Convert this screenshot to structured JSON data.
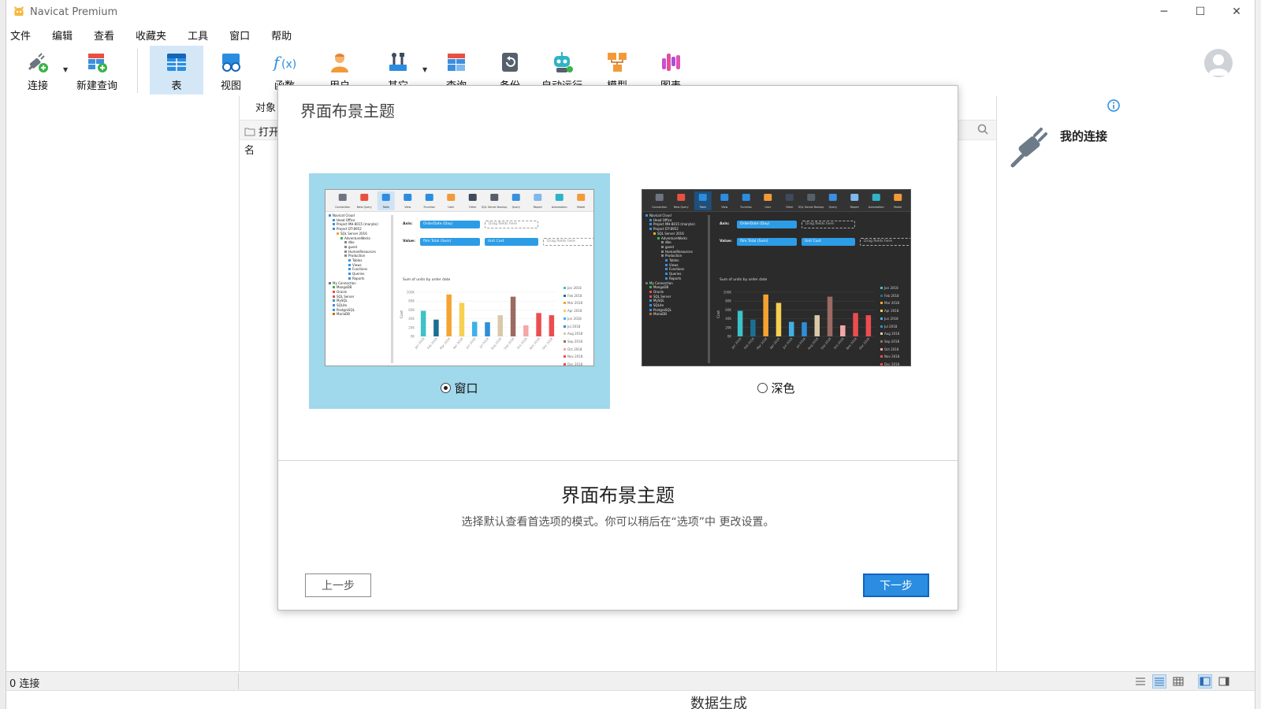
{
  "app": {
    "title": "Navicat Premium"
  },
  "menu": [
    "文件",
    "编辑",
    "查看",
    "收藏夹",
    "工具",
    "窗口",
    "帮助"
  ],
  "toolbar": [
    {
      "label": "连接",
      "icon": "connection-icon",
      "dropdown": true
    },
    {
      "label": "新建查询",
      "icon": "new-query-icon"
    },
    {
      "label": "表",
      "icon": "table-icon",
      "active": true
    },
    {
      "label": "视图",
      "icon": "view-icon"
    },
    {
      "label": "函数",
      "icon": "function-icon"
    },
    {
      "label": "用户",
      "icon": "user-icon"
    },
    {
      "label": "其它",
      "icon": "other-tools-icon",
      "dropdown": true
    },
    {
      "label": "查询",
      "icon": "query-icon"
    },
    {
      "label": "备份",
      "icon": "backup-icon"
    },
    {
      "label": "自动运行",
      "icon": "automation-icon"
    },
    {
      "label": "模型",
      "icon": "model-icon"
    },
    {
      "label": "图表",
      "icon": "chart-icon"
    }
  ],
  "main": {
    "objects_tab": "对象",
    "open_button": "打开",
    "name_column": "名"
  },
  "right_panel": {
    "title": "我的连接"
  },
  "statusbar": {
    "connections": "0 连接"
  },
  "background_text": "数据生成",
  "dialog": {
    "heading": "界面布景主题",
    "title": "界面布景主题",
    "description": "选择默认查看首选项的模式。你可以稍后在“选项”中 更改设置。",
    "prev_button": "上一步",
    "next_button": "下一步",
    "themes": [
      {
        "label": "窗口",
        "selected": true
      },
      {
        "label": "深色",
        "selected": false
      }
    ]
  },
  "preview": {
    "toolbar_labels": [
      "Connection",
      "New Query",
      "Table",
      "View",
      "Function",
      "User",
      "Other",
      "SQL Server Backup",
      "Query",
      "Report",
      "Automation",
      "Model"
    ],
    "tree": [
      "Navicat Cloud",
      "Head Office",
      "Project MH-8015 (marybn)",
      "Project DT-8952",
      "SQL Server 2016",
      "AdventureWorks",
      "dbo",
      "guest",
      "HumanResources",
      "Production",
      "Tables",
      "Views",
      "Functions",
      "Queries",
      "Reports",
      "My Connection",
      "MongoDB",
      "Oracle",
      "SQL Server",
      "MySQL",
      "SQLite",
      "PostgreSQL",
      "MariaDB"
    ],
    "axis_label": "Axis:",
    "axis_field": "OrderDate (Day)",
    "value_label": "Value:",
    "value_field": "film.Total (Sum)",
    "value_field2": "Unit Cost",
    "drag_placeholder": "Drag fields here",
    "chart_title": "Sum of units by order date",
    "y_axis": "Cost",
    "y_ticks": [
      "100K",
      "80K",
      "60K",
      "40K",
      "20K",
      "0K"
    ],
    "months": [
      "Jan 2018",
      "Feb 2018",
      "Mar 2018",
      "Apr 2018",
      "Jun 2018",
      "Jul 2018",
      "Aug 2018",
      "Sep 2018",
      "Oct 2018",
      "Nov 2018",
      "Dec 2018"
    ]
  },
  "chart_data": {
    "type": "bar",
    "title": "Sum of units by order date",
    "ylabel": "Cost",
    "ylim": [
      0,
      100000
    ],
    "categories": [
      "Jan 2018",
      "Feb 2018",
      "Mar 2018",
      "Apr 2018",
      "Jun 2018",
      "Jul 2018",
      "Aug 2018",
      "Sep 2018",
      "Oct 2018",
      "Nov 2018",
      "Dec 2018"
    ],
    "values": [
      58000,
      38000,
      95000,
      76000,
      33000,
      32000,
      48000,
      90000,
      25000,
      53000,
      48000
    ],
    "colors": [
      "#3cc2c8",
      "#1b6f94",
      "#f5a331",
      "#f6cf53",
      "#3fb1e8",
      "#2c8fd8",
      "#d9c9a9",
      "#9b6a62",
      "#f4a7a8",
      "#ec4d4f",
      "#ec4d4f"
    ]
  }
}
